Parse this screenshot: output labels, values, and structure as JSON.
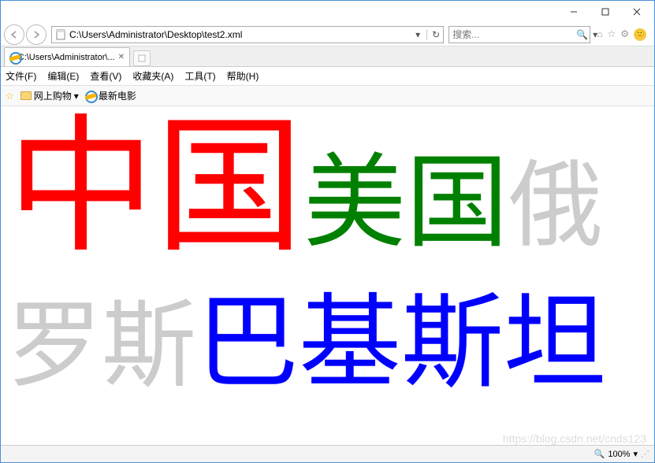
{
  "window": {
    "url": "C:\\Users\\Administrator\\Desktop\\test2.xml"
  },
  "search": {
    "placeholder": "搜索..."
  },
  "tab": {
    "title": "C:\\Users\\Administrator\\..."
  },
  "menu": {
    "file": "文件(F)",
    "edit": "编辑(E)",
    "view": "查看(V)",
    "favorites": "收藏夹(A)",
    "tools": "工具(T)",
    "help": "帮助(H)"
  },
  "favbar": {
    "shopping": "网上购物",
    "movies": "最新电影"
  },
  "content": {
    "china": "中国",
    "usa": "美国",
    "russia": "俄罗斯",
    "pakistan": "巴基斯坦"
  },
  "status": {
    "zoom": "100%"
  },
  "watermark": "https://blog.csdn.net/cnds123"
}
